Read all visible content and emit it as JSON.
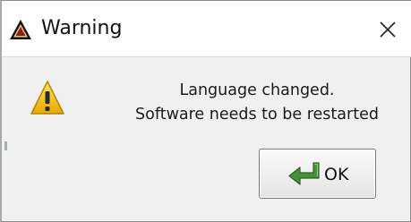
{
  "dialog": {
    "title": "Warning",
    "title_icon": "warning-triangle-icon",
    "close_icon": "close-icon",
    "message_line1": "Language changed.",
    "message_line2": "Software needs to be restarted",
    "message_icon": "warning-icon",
    "ok_label": "OK",
    "ok_icon": "green-arrow-icon"
  },
  "colors": {
    "titlebar_bg": "#ffffff",
    "body_bg": "#f0f0f0",
    "warning_yellow": "#f2c400",
    "ok_arrow_green": "#4a8f3a"
  }
}
